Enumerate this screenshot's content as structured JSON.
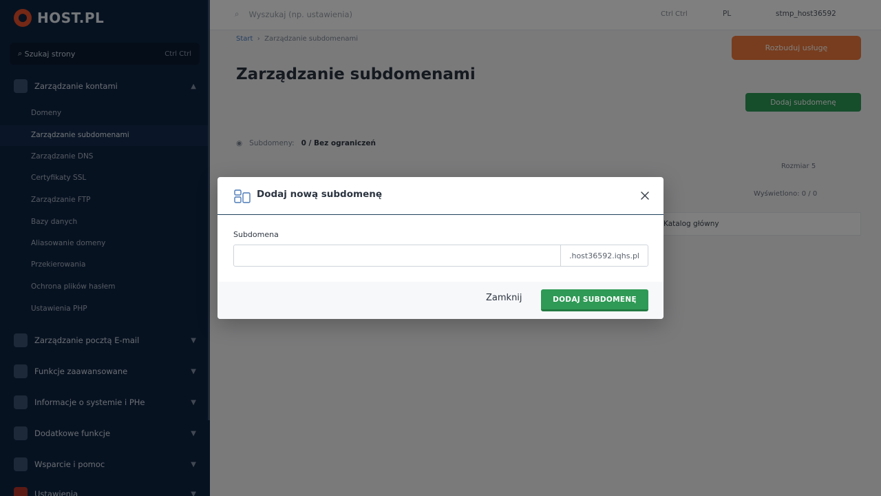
{
  "sidebar": {
    "brand": "HOST.PL",
    "search_label": "Szukaj strony",
    "search_shortcut": "Ctrl Ctrl",
    "groups": [
      {
        "label": "Zarządzanie kontami"
      },
      {
        "label": "Zarządzanie pocztą E-mail"
      },
      {
        "label": "Funkcje zaawansowane"
      },
      {
        "label": "Informacje o systemie i PHe"
      },
      {
        "label": "Dodatkowe funkcje"
      },
      {
        "label": "Wsparcie i pomoc"
      },
      {
        "label": "Ustawienia"
      }
    ],
    "subitems": [
      {
        "label": "Domeny"
      },
      {
        "label": "Zarządzanie subdomenami"
      },
      {
        "label": "Zarządzanie DNS"
      },
      {
        "label": "Certyfikaty SSL"
      },
      {
        "label": "Zarządzanie FTP"
      },
      {
        "label": "Bazy danych"
      },
      {
        "label": "Aliasowanie domeny"
      },
      {
        "label": "Przekierowania"
      },
      {
        "label": "Ochrona plików hasłem"
      },
      {
        "label": "Ustawienia PHP"
      }
    ]
  },
  "topbar": {
    "search_placeholder": "Wyszukaj (np. ustawienia)",
    "shortcut": "Ctrl Ctrl",
    "language": "PL",
    "user": "stmp_host36592"
  },
  "page": {
    "breadcrumb_home": "Start",
    "breadcrumb_current": "Zarządzanie subdomenami",
    "title": "Zarządzanie subdomenami",
    "upgrade_label": "Rozbuduj usługę",
    "add_button_label": "Dodaj subdomenę",
    "limit_label": "Subdomeny:",
    "limit_value": "0 / Bez ograniczeń",
    "per_page_label": "Rozmiar",
    "per_page_value": "5",
    "shown_label": "Wyświetlono: 0 / 0",
    "column_header": "Katalog główny"
  },
  "modal": {
    "title": "Dodaj nową subdomenę",
    "field_label": "Subdomena",
    "input_value": "",
    "input_placeholder": "",
    "suffix": ".host36592.iqhs.pl",
    "close_label": "Zamknij",
    "submit_label": "DODAJ SUBDOMENĘ"
  },
  "colors": {
    "primary_green": "#2e9a55",
    "accent_orange": "#f07a3c",
    "sidebar_bg": "#0f2442"
  }
}
